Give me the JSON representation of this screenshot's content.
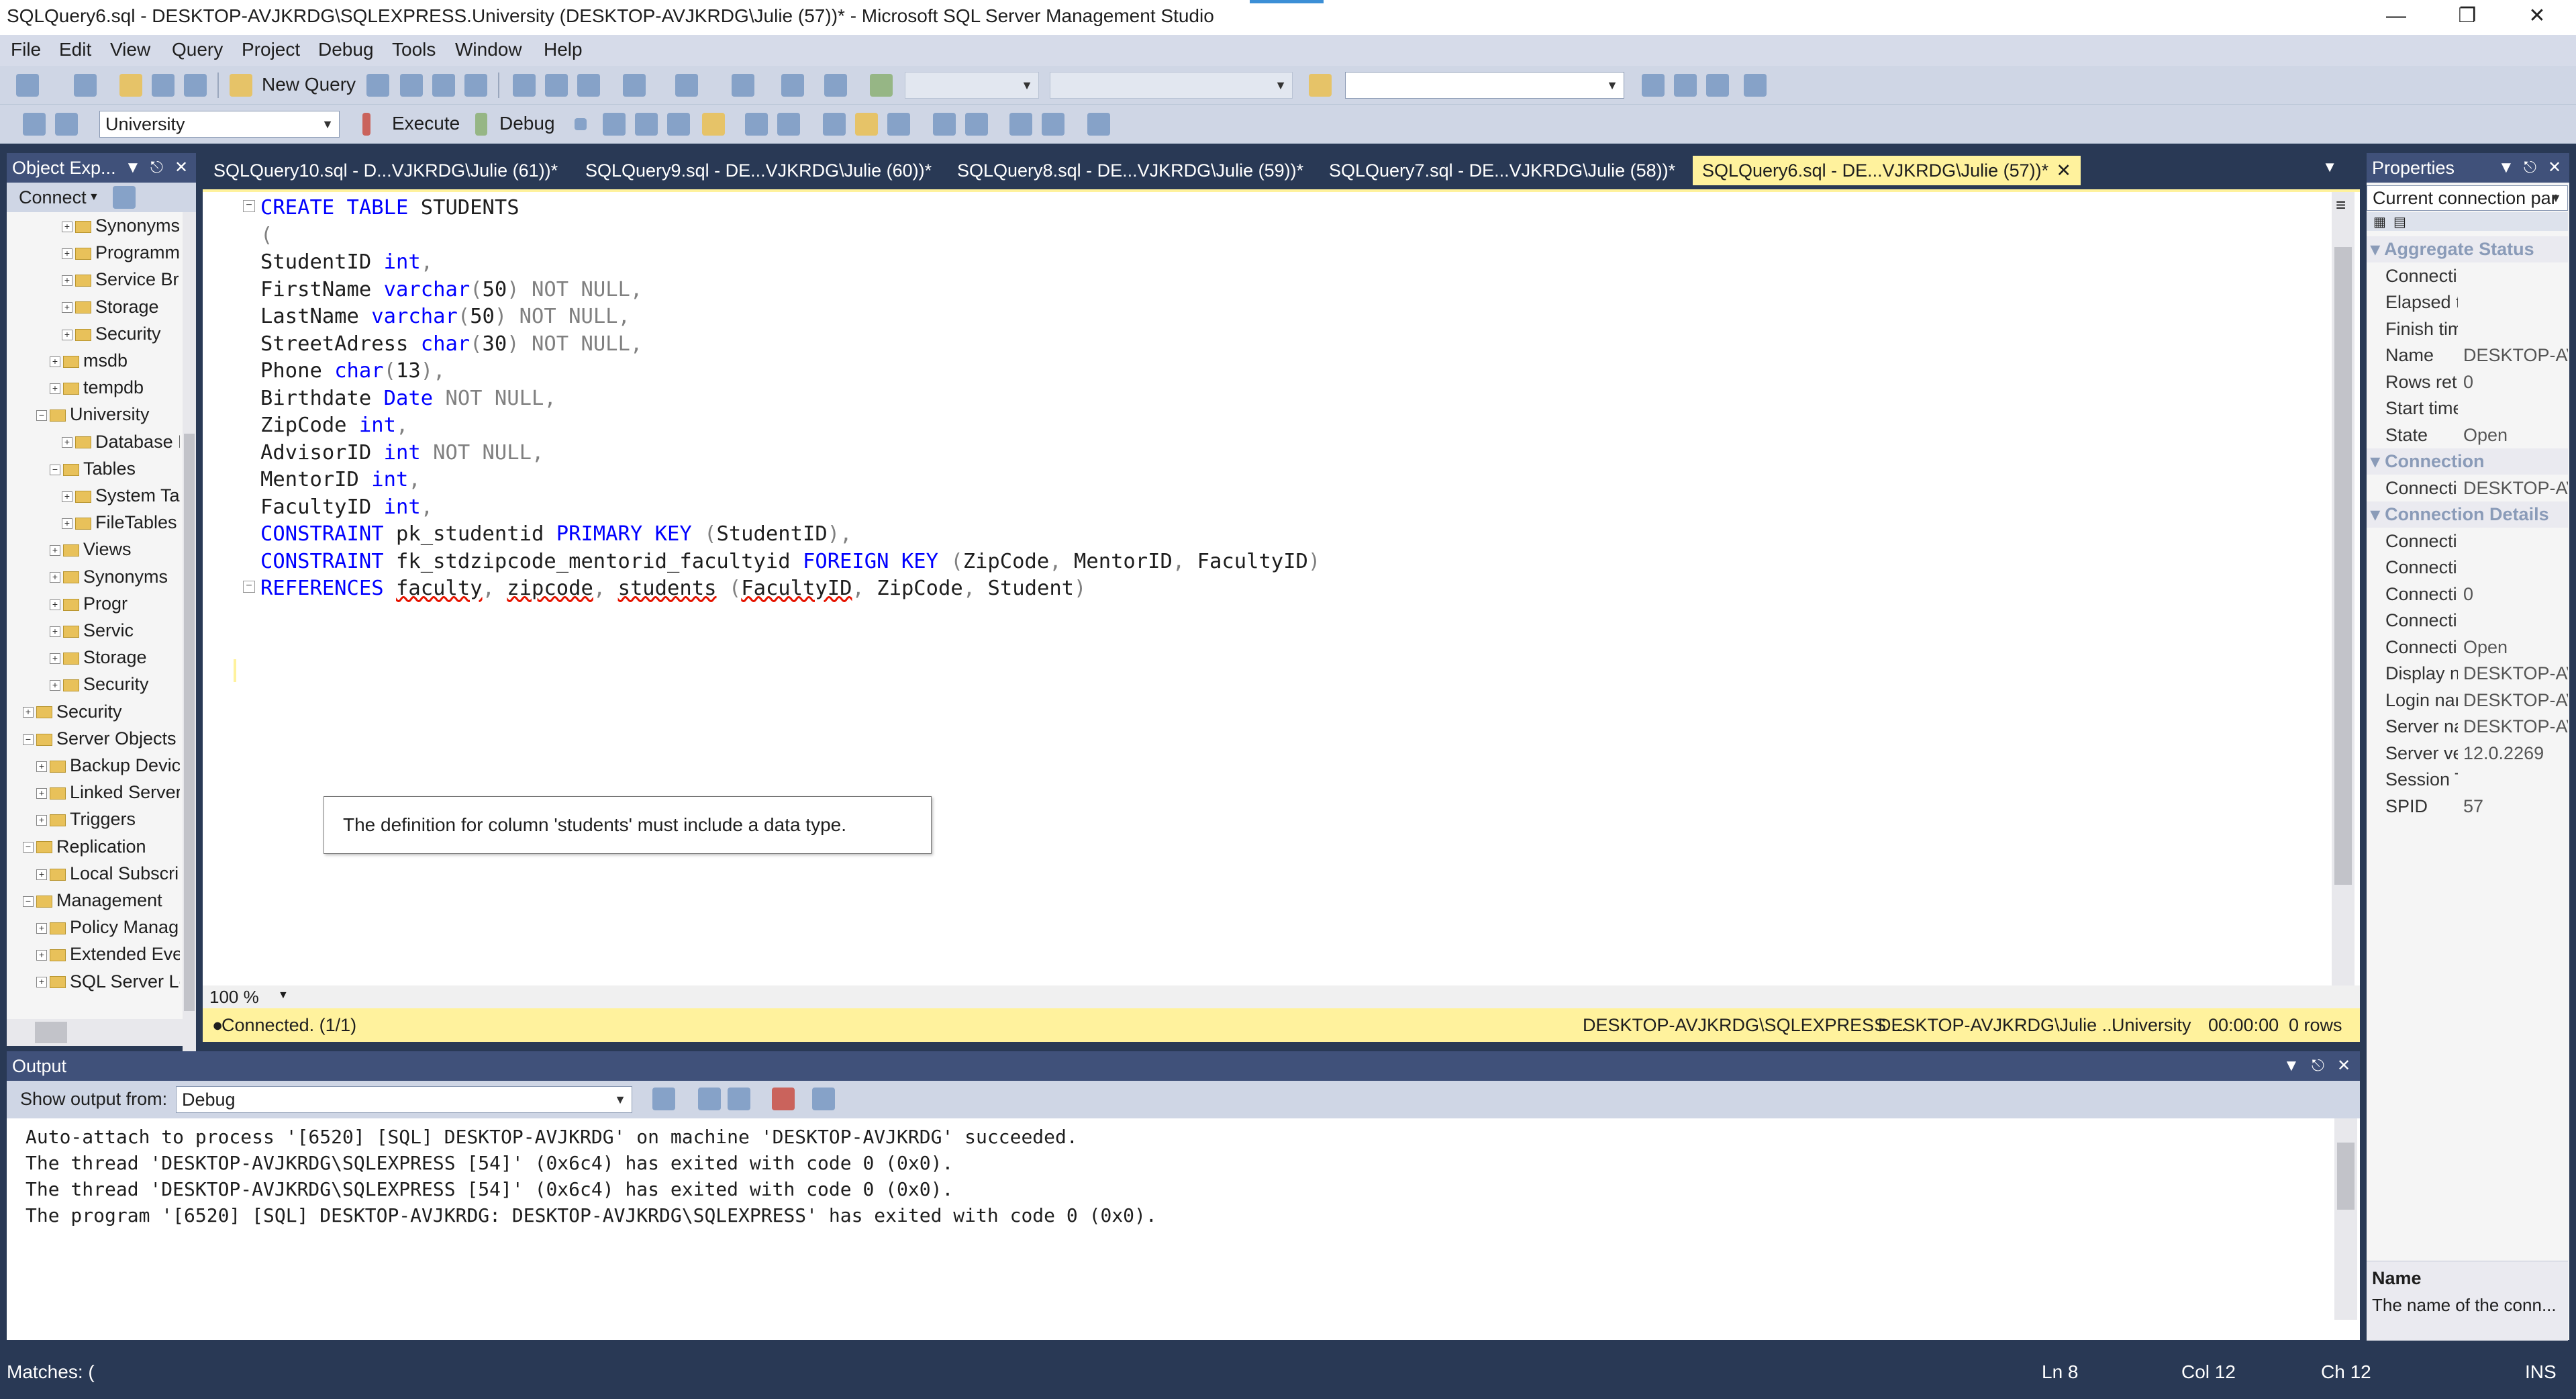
{
  "window": {
    "title": "SQLQuery6.sql - DESKTOP-AVJKRDG\\SQLEXPRESS.University (DESKTOP-AVJKRDG\\Julie (57))* - Microsoft SQL Server Management Studio",
    "minimize": "—",
    "restore": "❐",
    "close": "✕"
  },
  "menu": [
    "File",
    "Edit",
    "View",
    "Query",
    "Project",
    "Debug",
    "Tools",
    "Window",
    "Help"
  ],
  "toolbar1": {
    "new_query": "New Query"
  },
  "toolbar2": {
    "database": "University",
    "execute": "Execute",
    "debug": "Debug"
  },
  "object_explorer": {
    "title": "Object Exp...",
    "connect": "Connect",
    "nodes": [
      {
        "label": "Synonyms",
        "sign": "+"
      },
      {
        "label": "Programm",
        "sign": "+"
      },
      {
        "label": "Service Br",
        "sign": "+"
      },
      {
        "label": "Storage",
        "sign": "+"
      },
      {
        "label": "Security",
        "sign": "+"
      },
      {
        "label": "msdb",
        "sign": "+"
      },
      {
        "label": "tempdb",
        "sign": "+"
      },
      {
        "label": "University",
        "sign": "−"
      },
      {
        "label": "Database D",
        "sign": "+"
      },
      {
        "label": "Tables",
        "sign": "−"
      },
      {
        "label": "System Ta",
        "sign": "+"
      },
      {
        "label": "FileTables",
        "sign": "+"
      },
      {
        "label": "Views",
        "sign": "+"
      },
      {
        "label": "Synonyms",
        "sign": "+"
      },
      {
        "label": "Progr",
        "sign": "+"
      },
      {
        "label": "Servic",
        "sign": "+"
      },
      {
        "label": "Storage",
        "sign": "+"
      },
      {
        "label": "Security",
        "sign": "+"
      },
      {
        "label": "Security",
        "sign": "+"
      },
      {
        "label": "Server Objects",
        "sign": "−"
      },
      {
        "label": "Backup Devic",
        "sign": "+"
      },
      {
        "label": "Linked Server",
        "sign": "+"
      },
      {
        "label": "Triggers",
        "sign": "+"
      },
      {
        "label": "Replication",
        "sign": "−"
      },
      {
        "label": "Local Subscri",
        "sign": "+"
      },
      {
        "label": "Management",
        "sign": "−"
      },
      {
        "label": "Policy Manag",
        "sign": "+"
      },
      {
        "label": "Extended Eve",
        "sign": "+"
      },
      {
        "label": "SQL Server Lo",
        "sign": "+"
      }
    ]
  },
  "tabs": [
    {
      "label": "SQLQuery10.sql - D...VJKRDG\\Julie (61))*"
    },
    {
      "label": "SQLQuery9.sql - DE...VJKRDG\\Julie (60))*"
    },
    {
      "label": "SQLQuery8.sql - DE...VJKRDG\\Julie (59))*"
    },
    {
      "label": "SQLQuery7.sql - DE...VJKRDG\\Julie (58))*"
    },
    {
      "label": "SQLQuery6.sql - DE...VJKRDG\\Julie (57))*",
      "close": "✕"
    }
  ],
  "editor": {
    "zoom": "100 %",
    "tooltip": "The definition for column 'students' must include a data type."
  },
  "status": {
    "connected": "Connected. (1/1)",
    "server": "DESKTOP-AVJKRDG\\SQLEXPRESS ...",
    "user": "DESKTOP-AVJKRDG\\Julie ...",
    "database": "University",
    "time": "00:00:00",
    "rows": "0 rows"
  },
  "output": {
    "title": "Output",
    "show_from_label": "Show output from:",
    "source": "Debug",
    "lines": [
      "Auto-attach to process '[6520] [SQL] DESKTOP-AVJKRDG' on machine 'DESKTOP-AVJKRDG' succeeded.",
      "The thread 'DESKTOP-AVJKRDG\\SQLEXPRESS [54]' (0x6c4) has exited with code 0 (0x0).",
      "The thread 'DESKTOP-AVJKRDG\\SQLEXPRESS [54]' (0x6c4) has exited with code 0 (0x0).",
      "The program '[6520] [SQL] DESKTOP-AVJKRDG: DESKTOP-AVJKRDG\\SQLEXPRESS' has exited with code 0 (0x0)."
    ]
  },
  "properties": {
    "title": "Properties",
    "selector": "Current connection par",
    "cats": {
      "aggregate": "Aggregate Status",
      "connection": "Connection",
      "details": "Connection Details"
    },
    "aggregate": [
      {
        "name": "Connecti",
        "value": ""
      },
      {
        "name": "Elapsed t",
        "value": ""
      },
      {
        "name": "Finish tim",
        "value": ""
      },
      {
        "name": "Name",
        "value": "DESKTOP-AV"
      },
      {
        "name": "Rows retu",
        "value": "0"
      },
      {
        "name": "Start time",
        "value": ""
      },
      {
        "name": "State",
        "value": "Open"
      }
    ],
    "connection": [
      {
        "name": "Connecti",
        "value": "DESKTOP-AV"
      }
    ],
    "details": [
      {
        "name": "Connecti",
        "value": ""
      },
      {
        "name": "Connecti",
        "value": ""
      },
      {
        "name": "Connecti",
        "value": "0"
      },
      {
        "name": "Connecti",
        "value": ""
      },
      {
        "name": "Connecti",
        "value": "Open"
      },
      {
        "name": "Display n",
        "value": "DESKTOP-AV"
      },
      {
        "name": "Login nar",
        "value": "DESKTOP-AV"
      },
      {
        "name": "Server na",
        "value": "DESKTOP-AV"
      },
      {
        "name": "Server ve",
        "value": "12.0.2269"
      },
      {
        "name": "Session T",
        "value": ""
      },
      {
        "name": "SPID",
        "value": "57"
      }
    ],
    "desc_title": "Name",
    "desc_text": "The name of the conn..."
  },
  "bottom": {
    "matches": "Matches: (",
    "ln": "Ln 8",
    "col": "Col 12",
    "ch": "Ch 12",
    "ins": "INS"
  },
  "sql": [
    [
      {
        "t": "CREATE TABLE",
        "k": "kw"
      },
      {
        "t": " STUDENTS"
      }
    ],
    [
      {
        "t": "(",
        "k": "gr"
      }
    ],
    [
      {
        "t": "StudentID "
      },
      {
        "t": "int",
        "k": "kw"
      },
      {
        "t": ",",
        "k": "gr"
      }
    ],
    [
      {
        "t": "FirstName "
      },
      {
        "t": "varchar",
        "k": "kw"
      },
      {
        "t": "(",
        "k": "gr"
      },
      {
        "t": "50"
      },
      {
        "t": ") NOT NULL,",
        "k": "gr"
      }
    ],
    [
      {
        "t": "LastName "
      },
      {
        "t": "varchar",
        "k": "kw"
      },
      {
        "t": "(",
        "k": "gr"
      },
      {
        "t": "50"
      },
      {
        "t": ") NOT NULL,",
        "k": "gr"
      }
    ],
    [
      {
        "t": "StreetAdress "
      },
      {
        "t": "char",
        "k": "kw"
      },
      {
        "t": "(",
        "k": "gr"
      },
      {
        "t": "30"
      },
      {
        "t": ") NOT NULL,",
        "k": "gr"
      }
    ],
    [
      {
        "t": "Phone "
      },
      {
        "t": "char",
        "k": "kw"
      },
      {
        "t": "(",
        "k": "gr"
      },
      {
        "t": "13"
      },
      {
        "t": "),",
        "k": "gr"
      }
    ],
    [
      {
        "t": "Birthdate "
      },
      {
        "t": "Date",
        "k": "kw"
      },
      {
        "t": " NOT NULL,",
        "k": "gr"
      }
    ],
    [
      {
        "t": "ZipCode "
      },
      {
        "t": "int",
        "k": "kw"
      },
      {
        "t": ",",
        "k": "gr"
      }
    ],
    [
      {
        "t": "AdvisorID "
      },
      {
        "t": "int",
        "k": "kw"
      },
      {
        "t": " NOT NULL,",
        "k": "gr"
      }
    ],
    [
      {
        "t": "MentorID "
      },
      {
        "t": "int",
        "k": "kw"
      },
      {
        "t": ",",
        "k": "gr"
      }
    ],
    [
      {
        "t": "FacultyID "
      },
      {
        "t": "int",
        "k": "kw"
      },
      {
        "t": ",",
        "k": "gr"
      }
    ],
    [
      {
        "t": "CONSTRAINT",
        "k": "kw"
      },
      {
        "t": " pk_studentid "
      },
      {
        "t": "PRIMARY KEY",
        "k": "kw"
      },
      {
        "t": " (",
        "k": "gr"
      },
      {
        "t": "StudentID"
      },
      {
        "t": "),",
        "k": "gr"
      }
    ],
    [
      {
        "t": "CONSTRAINT",
        "k": "kw"
      },
      {
        "t": " fk_stdzipcode_mentorid_facultyid "
      },
      {
        "t": "FOREIGN KEY",
        "k": "kw"
      },
      {
        "t": " (",
        "k": "gr"
      },
      {
        "t": "ZipCode"
      },
      {
        "t": ", ",
        "k": "gr"
      },
      {
        "t": "MentorID"
      },
      {
        "t": ", ",
        "k": "gr"
      },
      {
        "t": "FacultyID"
      },
      {
        "t": ")",
        "k": "gr"
      }
    ],
    [
      {
        "t": "REFERENCES",
        "k": "kw"
      },
      {
        "t": " "
      },
      {
        "t": "faculty",
        "k": "err"
      },
      {
        "t": ", ",
        "k": "gr"
      },
      {
        "t": "zipcode",
        "k": "err"
      },
      {
        "t": ", ",
        "k": "gr"
      },
      {
        "t": "students",
        "k": "err"
      },
      {
        "t": " (",
        "k": "gr"
      },
      {
        "t": "FacultyID",
        "k": "err"
      },
      {
        "t": ", ",
        "k": "gr"
      },
      {
        "t": "ZipCode"
      },
      {
        "t": ", ",
        "k": "gr"
      },
      {
        "t": "Student"
      },
      {
        "t": ")",
        "k": "gr"
      }
    ]
  ]
}
